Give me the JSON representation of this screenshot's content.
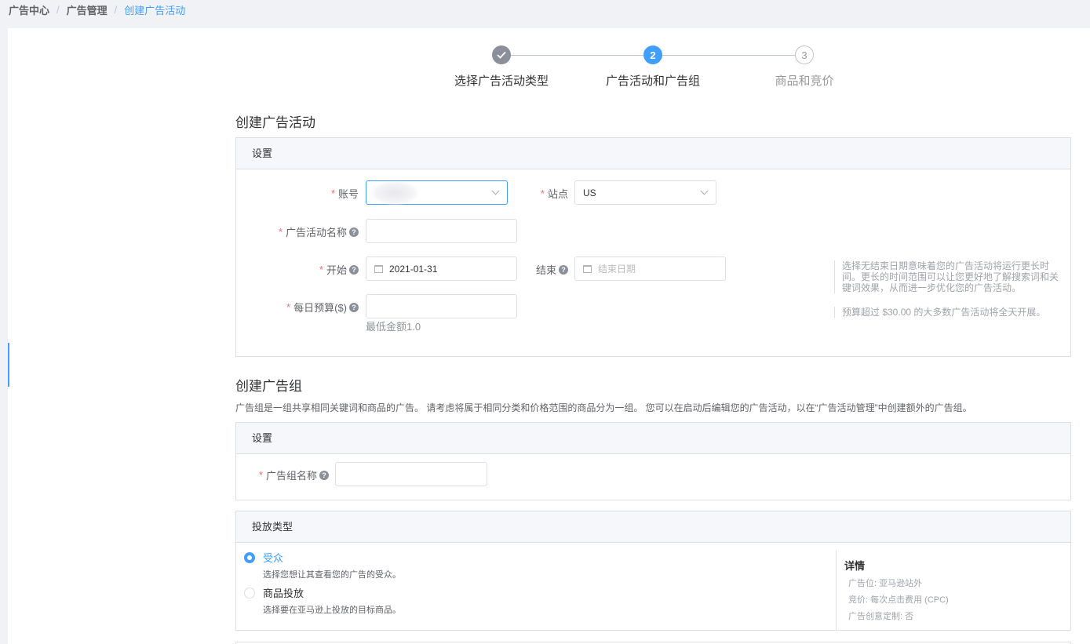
{
  "breadcrumb": {
    "items": [
      "广告中心",
      "广告管理",
      "创建广告活动"
    ],
    "separator": "/"
  },
  "steps": [
    {
      "index": "1",
      "label": "选择广告活动类型",
      "status": "done"
    },
    {
      "index": "2",
      "label": "广告活动和广告组",
      "status": "active"
    },
    {
      "index": "3",
      "label": "商品和竞价",
      "status": "todo"
    }
  ],
  "campaign": {
    "section_title": "创建广告活动",
    "card_header": "设置",
    "account": {
      "label": "账号",
      "required": "*"
    },
    "site": {
      "label": "站点",
      "required": "*",
      "value": "US"
    },
    "name": {
      "label": "广告活动名称",
      "required": "*",
      "value": ""
    },
    "start": {
      "label": "开始",
      "required": "*",
      "value": "2021-01-31"
    },
    "end": {
      "label": "结束",
      "placeholder": "结束日期"
    },
    "budget": {
      "label": "每日预算($)",
      "required": "*",
      "value": "",
      "min_tip": "最低金额1.0"
    },
    "end_hint": "选择无结束日期意味着您的广告活动将运行更长时间。更长的时间范围可以让您更好地了解搜索词和关键词效果，从而进一步优化您的广告活动。",
    "budget_hint": "预算超过 $30.00 的大多数广告活动将全天开展。"
  },
  "adgroup": {
    "section_title": "创建广告组",
    "description": "广告组是一组共享相同关键词和商品的广告。 请考虑将属于相同分类和价格范围的商品分为一组。 您可以在启动后编辑您的广告活动，以在“广告活动管理”中创建额外的广告组。",
    "card_header": "设置",
    "name": {
      "label": "广告组名称",
      "required": "*",
      "value": ""
    }
  },
  "targeting": {
    "card_header": "投放类型",
    "options": [
      {
        "title": "受众",
        "desc": "选择您想让其查看您的广告的受众。",
        "checked": true
      },
      {
        "title": "商品投放",
        "desc": "选择要在亚马逊上投放的目标商品。",
        "checked": false
      }
    ],
    "details": {
      "title": "详情",
      "rows": [
        "广告位:  亚马逊站外",
        "竞价: 每次点击费用 (CPC)",
        "广告创意定制:  否"
      ]
    }
  },
  "icons": {
    "check": "check-icon",
    "help": "question-circle-icon",
    "dropdown": "chevron-down-icon",
    "calendar": "calendar-icon"
  },
  "colors": {
    "primary": "#409eff",
    "required": "#f56c6c",
    "done_step": "#8a8f99"
  }
}
